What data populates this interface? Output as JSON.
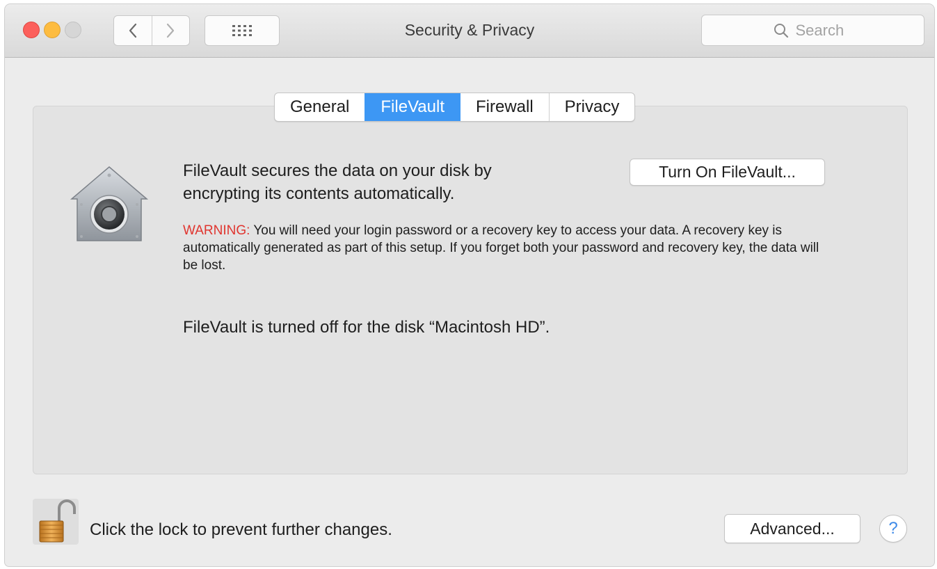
{
  "window": {
    "title": "Security & Privacy",
    "traffic_lights": [
      "close",
      "minimize",
      "zoom"
    ]
  },
  "toolbar": {
    "back_icon": "chevron-left-icon",
    "forward_icon": "chevron-right-icon",
    "grid_icon": "show-all-grid-icon",
    "search": {
      "placeholder": "Search",
      "value": "",
      "icon": "magnifying-glass-icon"
    }
  },
  "tabs": [
    {
      "label": "General",
      "selected": false
    },
    {
      "label": "FileVault",
      "selected": true
    },
    {
      "label": "Firewall",
      "selected": false
    },
    {
      "label": "Privacy",
      "selected": false
    }
  ],
  "filevault": {
    "icon": "filevault-house-vault-icon",
    "description": "FileVault secures the data on your disk by encrypting its contents automatically.",
    "turn_on_button": "Turn On FileVault...",
    "warning_label": "WARNING:",
    "warning_text": " You will need your login password or a recovery key to access your data. A recovery key is automatically generated as part of this setup. If you forget both your password and recovery key, the data will be lost.",
    "status": "FileVault is turned off for the disk “Macintosh HD”."
  },
  "footer": {
    "lock_icon": "unlocked-padlock-icon",
    "lock_message": "Click the lock to prevent further changes.",
    "advanced_button": "Advanced...",
    "help_label": "?"
  },
  "colors": {
    "accent": "#3d97f4",
    "warning": "#e0352f",
    "close": "#fc605c",
    "minimize": "#fdbc40",
    "zoom": "#d6d6d6"
  }
}
